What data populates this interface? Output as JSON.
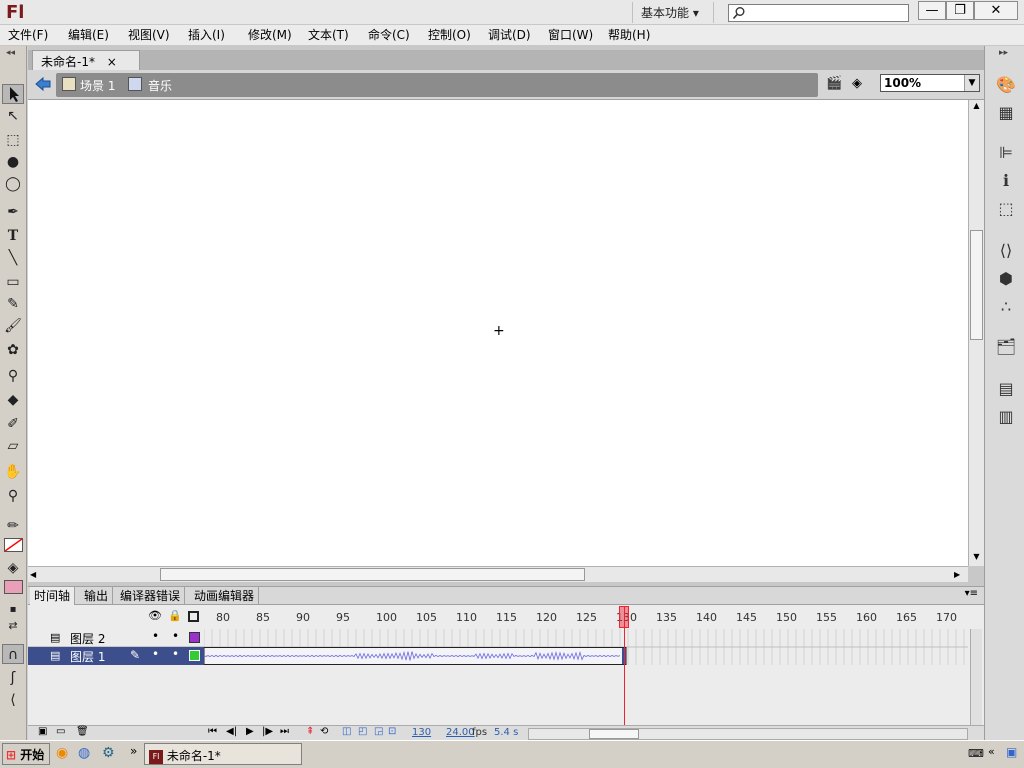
{
  "app": {
    "logo": "Fl",
    "workspace": "基本功能 ▾"
  },
  "window_controls": {
    "minimize": "—",
    "maximize": "❐",
    "close": "✕"
  },
  "search": {
    "icon": "magnifier-icon",
    "placeholder": ""
  },
  "menu": [
    "文件(F)",
    "编辑(E)",
    "视图(V)",
    "插入(I)",
    "修改(M)",
    "文本(T)",
    "命令(C)",
    "控制(O)",
    "调试(D)",
    "窗口(W)",
    "帮助(H)"
  ],
  "document": {
    "tab_title": "未命名-1*",
    "tab_close": "×"
  },
  "editbar": {
    "scene": "场景 1",
    "symbol": "音乐",
    "zoom": "100%"
  },
  "stage": {
    "crosshair": "+"
  },
  "timeline": {
    "tabs": [
      "时间轴",
      "输出",
      "编译器错误",
      "动画编辑器"
    ],
    "frame_numbers": [
      "80",
      "85",
      "90",
      "95",
      "100",
      "105",
      "110",
      "115",
      "120",
      "125",
      "130",
      "135",
      "140",
      "145",
      "150",
      "155",
      "160",
      "165",
      "170"
    ],
    "playhead_frame": 130,
    "layers": [
      {
        "name": "图层 2",
        "color": "#9933cc",
        "selected": false
      },
      {
        "name": "图层 1",
        "color": "#33cc33",
        "selected": true
      }
    ],
    "status": {
      "frame": "130",
      "fps": "24.00",
      "fps_unit": "fps",
      "time": "5.4 s"
    }
  },
  "taskbar": {
    "start": "开始",
    "task": "未命名-1*",
    "chevron": "»"
  },
  "colors": {
    "stroke": "#ff0000",
    "fill": "#e8a0b8",
    "playhead": "#e23"
  }
}
